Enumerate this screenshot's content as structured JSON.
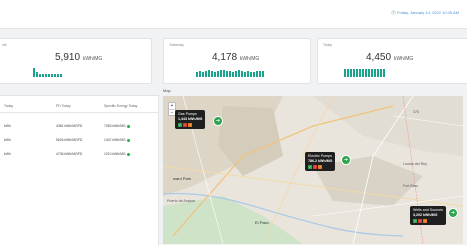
{
  "header": {
    "datetime": "🕘 Friday, January 14, 2022 10:45 AM",
    "accent": "#4a90d9"
  },
  "cards": [
    {
      "caption": "nth",
      "value": "5,910",
      "unit": "kWh/MG",
      "bars": [
        0.9,
        0.5,
        0.3,
        0.25,
        0.25,
        0.25,
        0.25,
        0.25,
        0.25,
        0.25
      ]
    },
    {
      "caption": "Yesterday",
      "value": "4,178",
      "unit": "kWh/MG",
      "bars": [
        0.5,
        0.6,
        0.45,
        0.55,
        0.7,
        0.6,
        0.5,
        0.6,
        0.65,
        0.7,
        0.6,
        0.55,
        0.5,
        0.6,
        0.7,
        0.6,
        0.5,
        0.6,
        0.45,
        0.5,
        0.55,
        0.6,
        0.55
      ]
    },
    {
      "caption": "Today",
      "value": "4,450",
      "unit": "kWh/MG",
      "bars": [
        0.8,
        0.8,
        0.8,
        0.8,
        0.8,
        0.8,
        0.8,
        0.8,
        0.8,
        0.8,
        0.8,
        0.8,
        0.8,
        0.8
      ]
    }
  ],
  "table": {
    "headers": [
      "Today",
      "PD Today",
      "Specific Energy Today"
    ],
    "rows": [
      [
        "kWh",
        "4381 kWh/MGPD",
        "7053 kWh/MG"
      ],
      [
        "kWh",
        "5626 kWh/MGPD",
        "1447 kWh/MG"
      ],
      [
        "kWh",
        "4736 kWh/MGPD",
        "1210 kWh/MG"
      ]
    ],
    "status_color": "#28a745"
  },
  "map": {
    "title": "Map",
    "zoom_in": "+",
    "zoom_out": "−",
    "popups": [
      {
        "title": "Gas Pumps",
        "value": "1,443 kWh/MG"
      },
      {
        "title": "Electric Pumps",
        "value": "786.2 kWh/MG"
      },
      {
        "title": "Wells and Sources",
        "value": "3,202 kWh/MG"
      }
    ],
    "labels": {
      "edward_park": "ward Park",
      "puerto": "Puerto de Anapra",
      "el_paso": "El Paso",
      "lomas": "Lomas del Rey",
      "fort_bliss": "Fort Bliss",
      "route": "375"
    }
  }
}
